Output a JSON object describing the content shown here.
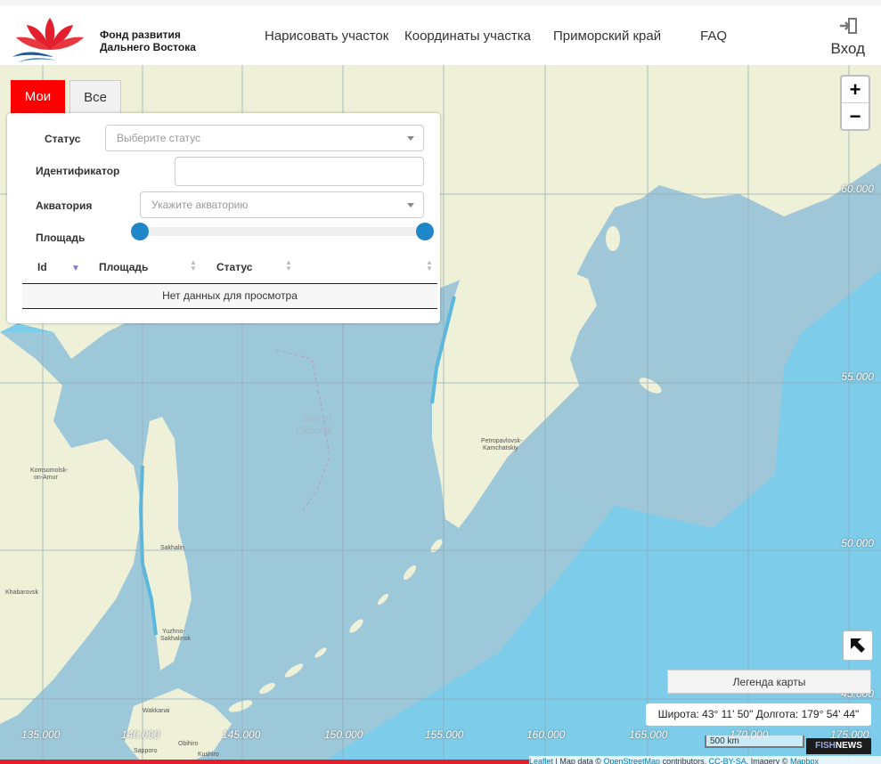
{
  "header": {
    "logo_text_1": "Фонд развития",
    "logo_text_2": "Дальнего Востока",
    "nav": [
      "Нарисовать участок",
      "Координаты участка",
      "Приморский край",
      "FAQ"
    ],
    "login_label": "Вход"
  },
  "map": {
    "zoom_in": "+",
    "zoom_out": "−",
    "lat_labels": [
      "60.000",
      "55.000",
      "50.000",
      "45.000"
    ],
    "lon_labels": [
      "135.000",
      "140.000",
      "145.000",
      "150.000",
      "155.000",
      "160.000",
      "165.000",
      "170.000",
      "175.000"
    ],
    "places": {
      "sea": "Sea of",
      "sea2": "Okhotsk",
      "petropavlovsk": "Petropavlovsk-",
      "kamchatsky": "Kamchatskiy",
      "komsomolsk": "Komsomolsk-",
      "on_amur": "on-Amur",
      "khabarovsk": "Khabarovsk",
      "sakhalin": "Sakhalin",
      "yuzhno": "Yuzhno-",
      "sakhalinsk": "Sakhalinsk",
      "wakkanai": "Wakkanai",
      "obihiro": "Obihiro",
      "sapporo": "Sapporo",
      "kushiro": "Kushiro"
    },
    "legend_button": "Легенда карты",
    "coords_text": "Широта: 43° 11' 50\" Долгота: 179° 54' 44\"",
    "scale_text": "500 km",
    "badge_fish": "FISH",
    "badge_news": "NEWS",
    "attribution": {
      "leaflet": "Leaflet",
      "mapdata": " | Map data © ",
      "osm": "OpenStreetMap",
      "contributors": " contributors, ",
      "ccbysa": "CC-BY-SA",
      "imagery": ", Imagery © ",
      "mapbox": "Mapbox"
    },
    "colors": {
      "sea": "#7dcdea",
      "zone": "#9fc7d8",
      "land": "#eef0d8"
    }
  },
  "panel": {
    "tabs": {
      "active": "Мои",
      "inactive": "Все"
    },
    "status_label": "Статус",
    "status_placeholder": "Выберите статус",
    "id_label": "Идентификатор",
    "id_value": "",
    "aquatory_label": "Акватория",
    "aquatory_placeholder": "Укажите акваторию",
    "area_label": "Площадь",
    "table": {
      "columns": [
        "Id",
        "Площадь",
        "Статус"
      ],
      "empty_text": "Нет данных для просмотра"
    }
  }
}
